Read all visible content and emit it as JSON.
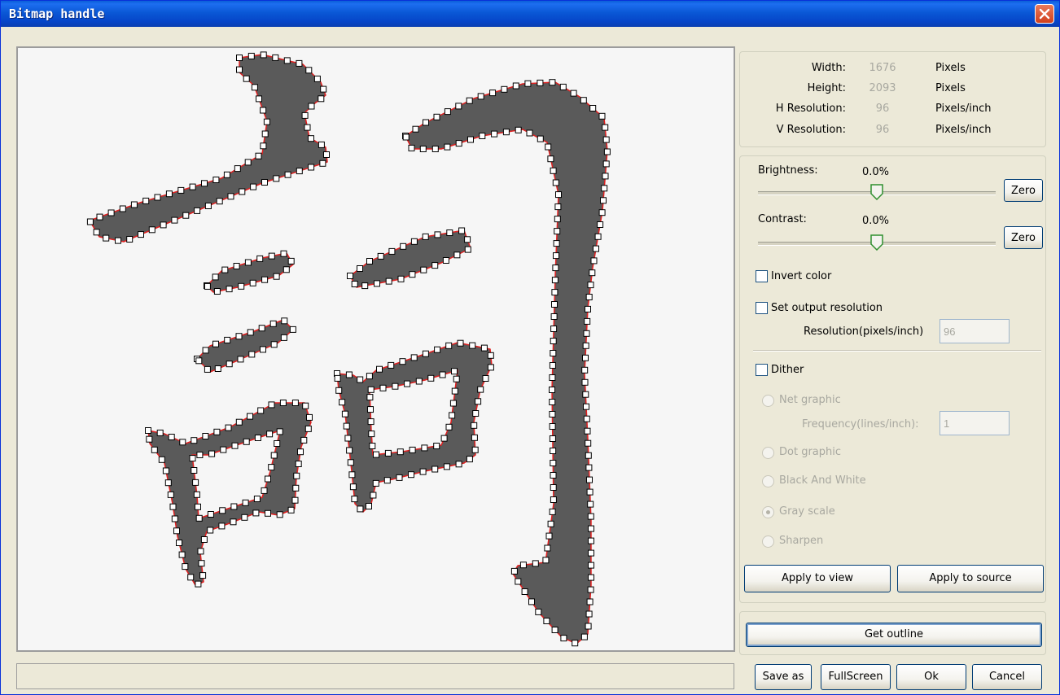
{
  "window": {
    "title": "Bitmap handle"
  },
  "info": {
    "width_label": "Width:",
    "width_value": "1676",
    "width_unit": "Pixels",
    "height_label": "Height:",
    "height_value": "2093",
    "height_unit": "Pixels",
    "hres_label": "H Resolution:",
    "hres_value": "96",
    "hres_unit": "Pixels/inch",
    "vres_label": "V Resolution:",
    "vres_value": "96",
    "vres_unit": "Pixels/inch"
  },
  "adjust": {
    "brightness_label": "Brightness:",
    "brightness_value": "0.0%",
    "brightness_level": 0.5,
    "contrast_label": "Contrast:",
    "contrast_value": "0.0%",
    "contrast_level": 0.5,
    "zero_label": "Zero"
  },
  "options": {
    "invert_label": "Invert color",
    "invert_checked": false,
    "set_res_label": "Set output resolution",
    "set_res_checked": false,
    "resolution_label": "Resolution(pixels/inch)",
    "resolution_value": "96",
    "dither_label": "Dither",
    "dither_checked": false,
    "net_graphic_label": "Net graphic",
    "frequency_label": "Frequency(lines/inch):",
    "frequency_value": "1",
    "dot_graphic_label": "Dot graphic",
    "bw_label": "Black And White",
    "grayscale_label": "Gray scale",
    "sharpen_label": "Sharpen",
    "selected_mode": "Gray scale"
  },
  "buttons": {
    "apply_view": "Apply to view",
    "apply_source": "Apply to source",
    "get_outline": "Get outline",
    "save_as": "Save as",
    "fullscreen": "FullScreen",
    "ok": "Ok",
    "cancel": "Cancel"
  },
  "colors": {
    "outline": "#e02020",
    "stroke_fill": "#5a5a5a",
    "accent": "#0a5fd8"
  }
}
